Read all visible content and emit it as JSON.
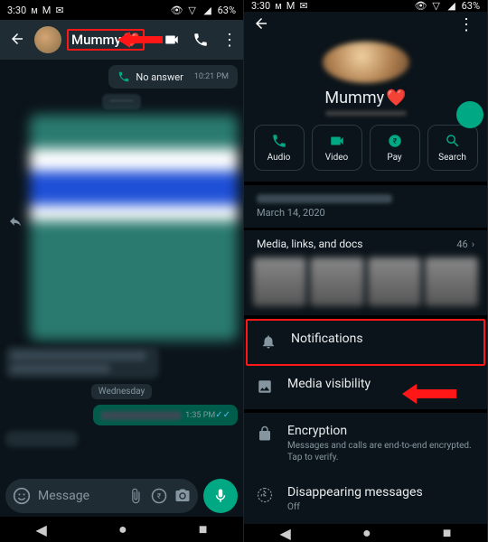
{
  "status": {
    "time": "3:30",
    "icons_left": [
      "M",
      "M",
      "gear"
    ],
    "battery": "63%"
  },
  "left": {
    "contact_name": "Mummy",
    "heart": "❤️",
    "missed": {
      "label": "No answer",
      "time": "10:21 PM"
    },
    "day_label": "Wednesday",
    "bubble_time": "1:35 PM",
    "input_placeholder": "Message"
  },
  "right": {
    "contact_name": "Mummy",
    "heart": "❤️",
    "actions": {
      "audio": "Audio",
      "video": "Video",
      "pay": "Pay",
      "search": "Search"
    },
    "about_date": "March 14, 2020",
    "media_label": "Media, links, and docs",
    "media_count": "46",
    "items": {
      "notifications": "Notifications",
      "media_vis": "Media visibility",
      "encryption": "Encryption",
      "encryption_sub": "Messages and calls are end-to-end encrypted. Tap to verify.",
      "disappearing": "Disappearing messages",
      "disappearing_sub": "Off"
    }
  }
}
